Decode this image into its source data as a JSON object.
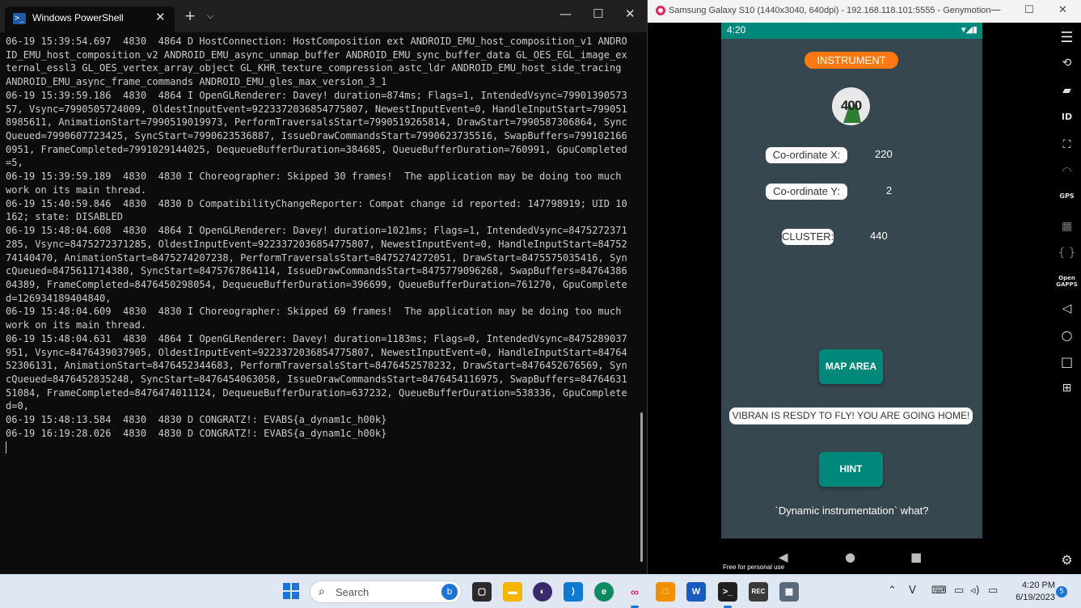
{
  "powershell": {
    "tab_title": "Windows PowerShell",
    "tab_close": "✕",
    "new_tab": "+",
    "dropdown": "⌵",
    "minimize": "—",
    "maximize": "☐",
    "close": "✕",
    "terminal_text": "06-19 15:39:54.697  4830  4864 D HostConnection: HostComposition ext ANDROID_EMU_host_composition_v1 ANDROID_EMU_host_composition_v2 ANDROID_EMU_async_unmap_buffer ANDROID_EMU_sync_buffer_data GL_OES_EGL_image_external_essl3 GL_OES_vertex_array_object GL_KHR_texture_compression_astc_ldr ANDROID_EMU_host_side_tracing ANDROID_EMU_async_frame_commands ANDROID_EMU_gles_max_version_3_1\n06-19 15:39:59.186  4830  4864 I OpenGLRenderer: Davey! duration=874ms; Flags=1, IntendedVsync=7990139057357, Vsync=7990505724009, OldestInputEvent=9223372036854775807, NewestInputEvent=0, HandleInputStart=7990518985611, AnimationStart=7990519019973, PerformTraversalsStart=7990519265814, DrawStart=7990587306864, SyncQueued=7990607723425, SyncStart=7990623536887, IssueDrawCommandsStart=7990623735516, SwapBuffers=7991021660951, FrameCompleted=7991029144025, DequeueBufferDuration=384685, QueueBufferDuration=760991, GpuCompleted=5,\n06-19 15:39:59.189  4830  4830 I Choreographer: Skipped 30 frames!  The application may be doing too much work on its main thread.\n06-19 15:40:59.846  4830  4830 D CompatibilityChangeReporter: Compat change id reported: 147798919; UID 10162; state: DISABLED\n06-19 15:48:04.608  4830  4864 I OpenGLRenderer: Davey! duration=1021ms; Flags=1, IntendedVsync=8475272371285, Vsync=8475272371285, OldestInputEvent=9223372036854775807, NewestInputEvent=0, HandleInputStart=8475274140470, AnimationStart=8475274207238, PerformTraversalsStart=8475274272051, DrawStart=8475575035416, SyncQueued=8475611714380, SyncStart=8475767864114, IssueDrawCommandsStart=8475779096268, SwapBuffers=8476438604389, FrameCompleted=8476450298054, DequeueBufferDuration=396699, QueueBufferDuration=761270, GpuCompleted=126934189404840,\n06-19 15:48:04.609  4830  4830 I Choreographer: Skipped 69 frames!  The application may be doing too much work on its main thread.\n06-19 15:48:04.631  4830  4864 I OpenGLRenderer: Davey! duration=1183ms; Flags=0, IntendedVsync=8475289037951, Vsync=8476439037905, OldestInputEvent=9223372036854775807, NewestInputEvent=0, HandleInputStart=8476452306131, AnimationStart=8476452344683, PerformTraversalsStart=8476452578232, DrawStart=8476452676569, SyncQueued=8476452835248, SyncStart=8476454063058, IssueDrawCommandsStart=8476454116975, SwapBuffers=8476463151084, FrameCompleted=8476474011124, DequeueBufferDuration=637232, QueueBufferDuration=538336, GpuCompleted=0,\n06-19 15:48:13.584  4830  4830 D CONGRATZ!: EVABS{a_dynam1c_h00k}\n06-19 16:19:28.026  4830  4830 D CONGRATZ!: EVABS{a_dynam1c_h00k}\n"
  },
  "genymotion": {
    "window_title": "Samsung Galaxy S10 (1440x3040, 640dpi) - 192.168.118.101:5555 - Genymotion",
    "minimize": "—",
    "maximize": "☐",
    "close": "✕",
    "free_label": "Free for personal use",
    "side_icons": [
      "menu-icon",
      "rotate-icon",
      "clapper-icon",
      "id-icon",
      "fullscreen-icon",
      "wifi-icon",
      "gps-icon",
      "media-icon",
      "code-icon",
      "opengapps-icon",
      "back-icon",
      "home-icon",
      "recents-icon",
      "add-icon",
      "settings-icon"
    ],
    "phone": {
      "clock": "4:20",
      "status_icons": "▾◢▮",
      "instrument_label": "INSTRUMENT",
      "logo_text": "400",
      "coord_x_label": "Co-ordinate X:",
      "coord_x_value": "220",
      "coord_y_label": "Co-ordinate Y:",
      "coord_y_value": "2",
      "cluster_label": "CLUSTER:",
      "cluster_value": "440",
      "map_area_button": "MAP AREA",
      "message": "VIBRAN IS RESDY TO FLY! YOU ARE GOING HOME!",
      "hint_button": "HINT",
      "footer_text": "`Dynamic instrumentation` what?"
    }
  },
  "taskbar": {
    "search_placeholder": "Search",
    "time": "4:20 PM",
    "date": "6/19/2023",
    "notifications": "5",
    "colors": {
      "accent": "#1e74d6",
      "teal": "#00897b",
      "orange": "#ff7811"
    }
  }
}
